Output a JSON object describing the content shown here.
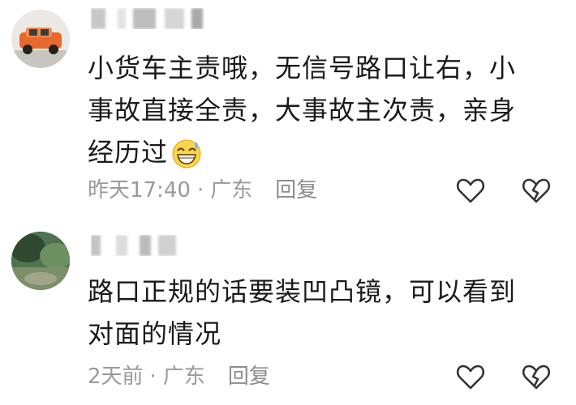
{
  "comments": [
    {
      "text_lines": [
        "小货车主责哦，无信号路口让右，小",
        "事故直接全责，大事故主次责，亲身",
        "经历过"
      ],
      "emoji": "grinning-sweat-emoji",
      "time": "昨天17:40",
      "separator": "·",
      "location": "广东",
      "reply_label": "回复"
    },
    {
      "text_lines": [
        "路口正规的话要装凹凸镜，可以看到",
        "对面的情况"
      ],
      "time": "2天前",
      "separator": "·",
      "location": "广东",
      "reply_label": "回复"
    }
  ],
  "icons": {
    "like": "heart-outline-icon",
    "dislike": "broken-heart-icon"
  },
  "colors": {
    "text": "#1a1a1a",
    "meta": "#9a9a9a",
    "icon": "#333333"
  }
}
